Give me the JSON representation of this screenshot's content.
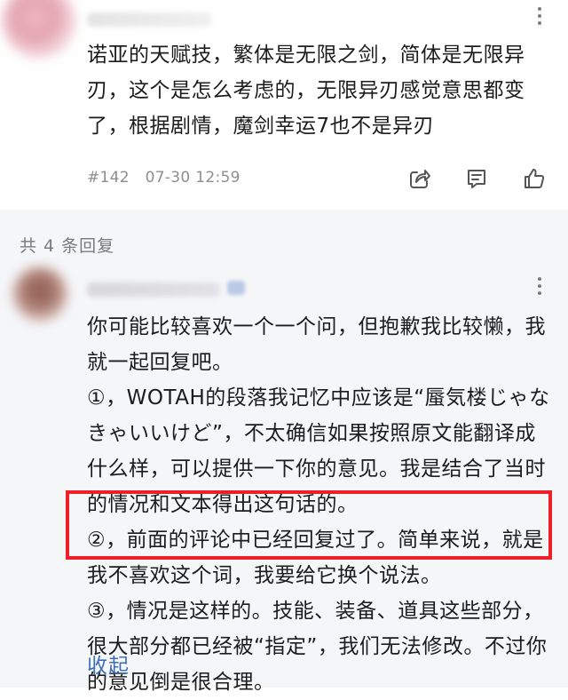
{
  "post": {
    "text": "诺亚的天赋技，繁体是无限之剑，简体是无限异刃，这个是怎么考虑的，无限异刃感觉意思都变了，根据剧情，魔剑幸运7也不是异刃",
    "floor": "#142",
    "time": "07-30 12:59",
    "share_icon": "share-icon",
    "comment_icon": "comment-icon",
    "like_icon": "thumbs-up-icon"
  },
  "replies": {
    "count_label": "共 4 条回复",
    "reply": {
      "paragraphs": [
        "你可能比较喜欢一个一个问，但抱歉我比较懒，我就一起回复吧。",
        "①，WOTAH的段落我记忆中应该是“蜃気楼じゃなきゃいいけど”，不太确信如果按照原文能翻译成什么样，可以提供一下你的意见。我是结合了当时的情况和文本得出这句话的。",
        "②，前面的评论中已经回复过了。简单来说，就是我不喜欢这个词，我要给它换个说法。",
        "③，情况是这样的。技能、装备、道具这些部分，很大部分都已经被“指定”，我们无法修改。不过你的意见倒是很合理。"
      ],
      "collapse_label": "收起"
    }
  },
  "colors": {
    "highlight": "#ee1e2a",
    "link": "#3f6fb5",
    "meta": "#8e8e8e"
  }
}
